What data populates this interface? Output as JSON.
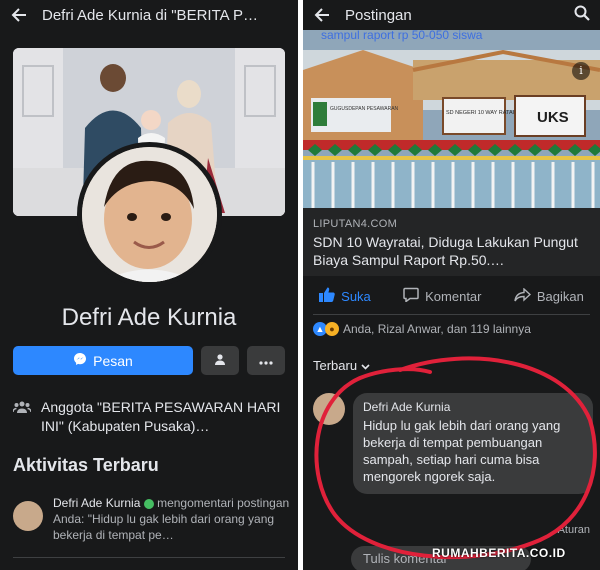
{
  "left": {
    "title": "Defri Ade Kurnia di \"BERITA P…",
    "profile_name": "Defri Ade Kurnia",
    "message_button": "Pesan",
    "group_text": "Anggota \"BERITA PESAWARAN HARI INI\" (Kabupaten Pusaka)…",
    "activity_title": "Aktivitas Terbaru",
    "activity": {
      "name": "Defri Ade Kurnia",
      "text": "mengomentari postingan Anda: \"Hidup lu gak lebih dari orang yang bekerja di tempat pe…"
    }
  },
  "right": {
    "title": "Postingan",
    "photo_caption": "sampul raport rp 50-050 siswa",
    "signs": {
      "left": "GUGUSDEPAN PESAWARAN",
      "mid": "SD NEGERI 10 WAY RATAI",
      "right": "UKS"
    },
    "link_source": "LIPUTAN4.COM",
    "link_title": "SDN 10 Wayratai, Diduga Lakukan Pungut Biaya Sampul Raport Rp.50.…",
    "actions": {
      "like": "Suka",
      "comment": "Komentar",
      "share": "Bagikan"
    },
    "reactions_text": "Anda, Rizal Anwar, dan 119 lainnya",
    "sort_label": "Terbaru",
    "comment": {
      "name": "Defri Ade Kurnia",
      "body": "Hidup lu gak lebih dari orang yang bekerja di tempat pembuangan sampah, setiap hari cuma bisa mengorek ngorek saja."
    },
    "rules_link": "Aturan",
    "write_placeholder": "Tulis komentar",
    "watermark": "RUMAHBERITA.CO.ID"
  },
  "colors": {
    "background": "#18191a",
    "card": "#242526",
    "bubble": "#3a3b3c",
    "accent": "#2d88ff",
    "annotation": "#e0213a"
  },
  "icons": [
    "back-arrow-icon",
    "search-icon",
    "messenger-icon",
    "person-icon",
    "more-icon",
    "group-icon",
    "like-icon",
    "comment-icon",
    "share-icon",
    "info-icon"
  ]
}
